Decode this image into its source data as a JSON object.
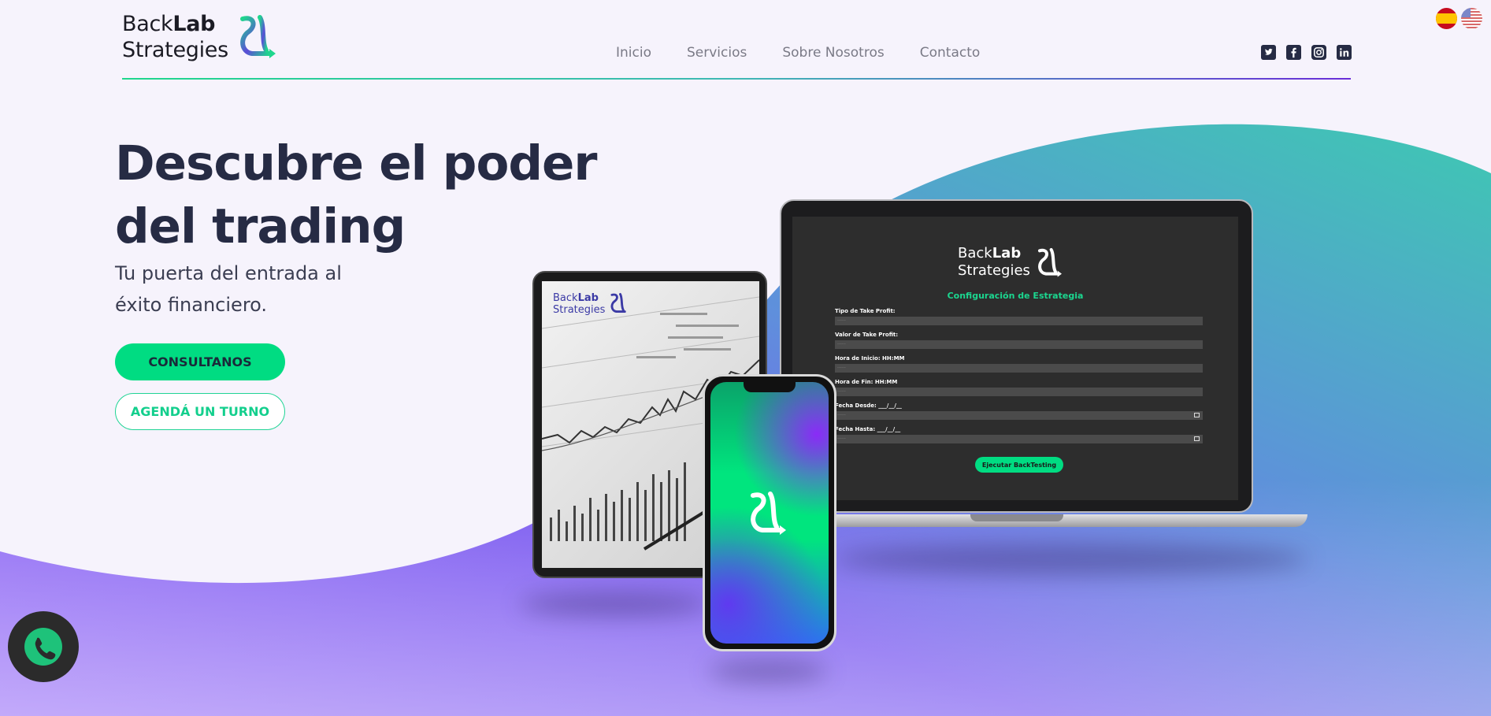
{
  "brand": {
    "name_light": "Back",
    "name_bold": "Lab",
    "name_line2": "Strategies"
  },
  "nav": {
    "items": [
      "Inicio",
      "Servicios",
      "Sobre Nosotros",
      "Contacto"
    ]
  },
  "social": {
    "icons": [
      "twitter-icon",
      "facebook-icon",
      "instagram-icon",
      "linkedin-icon"
    ]
  },
  "languages": [
    "es-flag",
    "us-flag"
  ],
  "hero": {
    "title": "Descubre el poder del trading",
    "subtitle": "Tu puerta del entrada al éxito financiero.",
    "cta_primary": "CONSULTANOS",
    "cta_secondary": "AGENDÁ UN TURNO"
  },
  "laptop_screen": {
    "title": "Configuración de Estrategia",
    "fields": [
      {
        "label": "Tipo de Take Profit:",
        "placeholder": "------"
      },
      {
        "label": "Valor de Take Profit:",
        "placeholder": "------"
      },
      {
        "label": "Hora de Inicio: HH:MM",
        "placeholder": "------"
      },
      {
        "label": "Hora de Fin: HH:MM",
        "placeholder": "------"
      },
      {
        "label": "Fecha Desde: ___/__/__",
        "placeholder": "------"
      },
      {
        "label": "Fecha Hasta: ___/__/__",
        "placeholder": "------"
      }
    ],
    "button": "Ejecutar BackTesting"
  },
  "colors": {
    "accent": "#00dc82",
    "purple": "#8b5cf6",
    "teal": "#40c0b0",
    "dark": "#262b44"
  }
}
